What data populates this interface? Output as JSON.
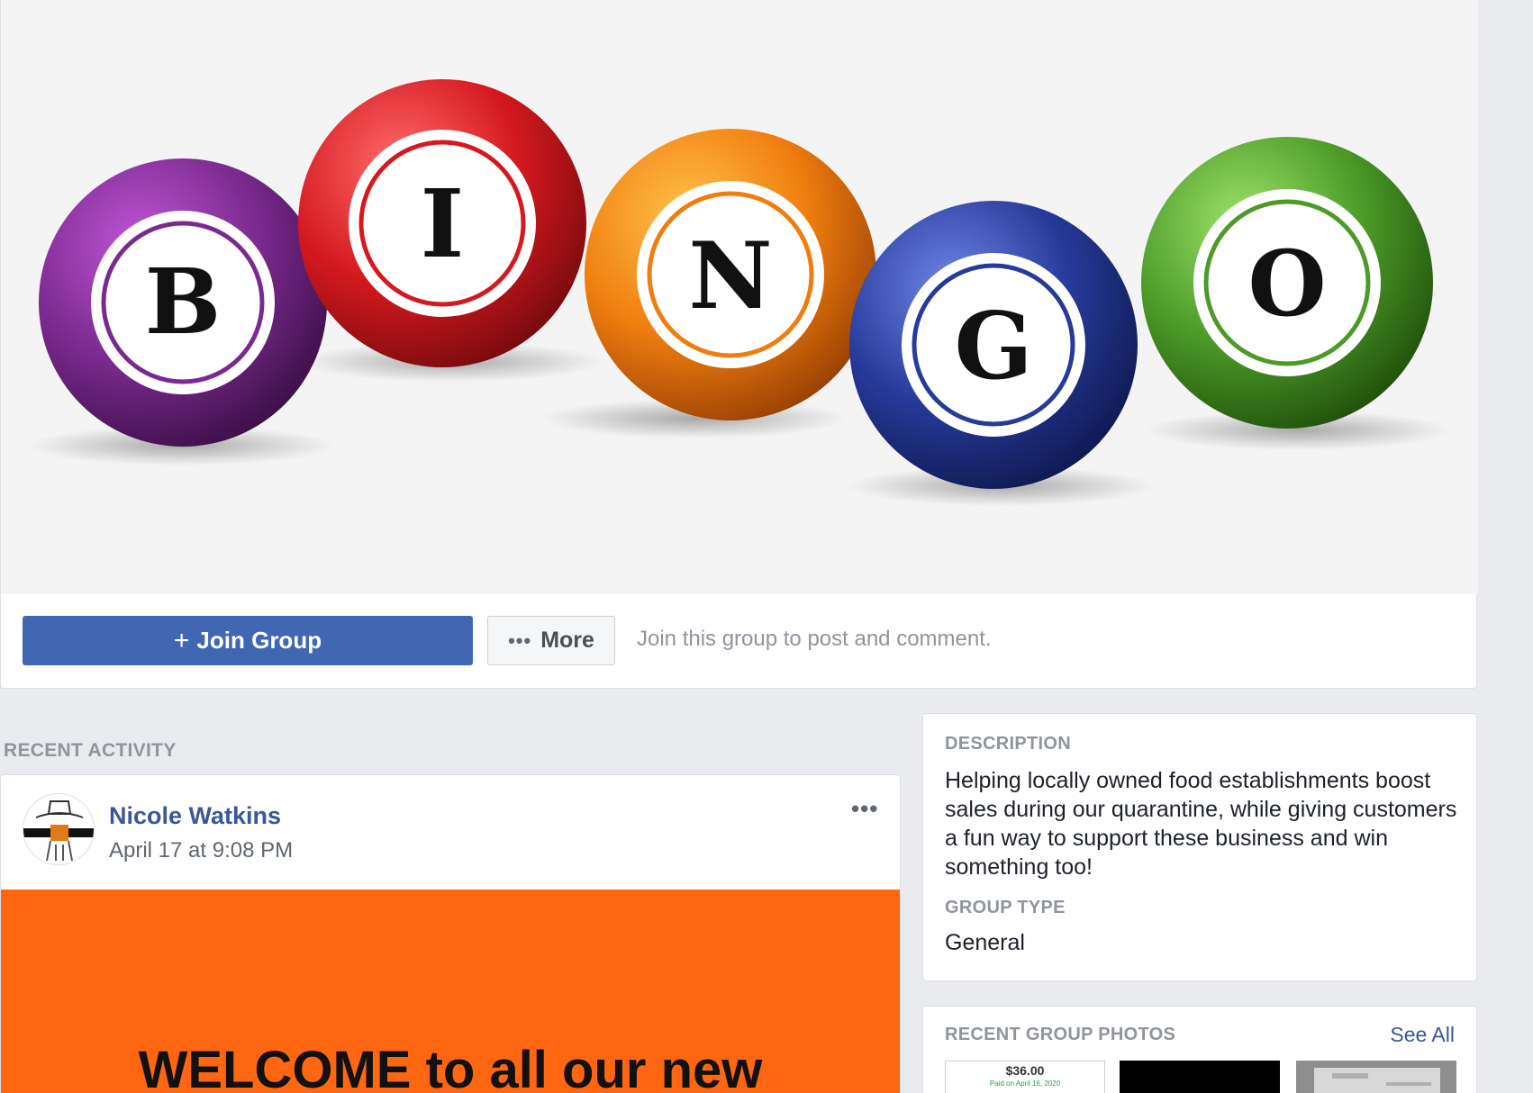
{
  "cover": {
    "letters": [
      "B",
      "I",
      "N",
      "G",
      "O"
    ],
    "colors": {
      "B": "#7a2a8f",
      "I": "#d4191f",
      "N": "#f07d0f",
      "G": "#263a99",
      "O": "#4c9a28"
    }
  },
  "actions": {
    "join_label": "Join Group",
    "join_icon": "plus-icon",
    "more_label": "More",
    "more_icon": "ellipsis-icon",
    "hint": "Join this group to post and comment."
  },
  "recent_activity": {
    "section_title": "RECENT ACTIVITY",
    "post": {
      "author": "Nicole Watkins",
      "time": "April 17 at 9:08 PM",
      "menu_icon": "ellipsis-icon",
      "image_color": "#ff6612",
      "image_text": "WELCOME to all our new"
    }
  },
  "about": {
    "description_title": "DESCRIPTION",
    "description": "Helping locally owned food establishments boost sales during our quarantine, while giving customers a fun way to support these business and win something too!",
    "group_type_title": "GROUP TYPE",
    "group_type": "General"
  },
  "photos": {
    "title": "RECENT GROUP PHOTOS",
    "see_all": "See All",
    "thumb1_amount": "$36.00",
    "thumb1_caption": "Paid on April 16, 2020"
  },
  "theme": {
    "brand_blue": "#4267b2",
    "link_blue": "#385898",
    "page_bg": "#e9ebee"
  }
}
